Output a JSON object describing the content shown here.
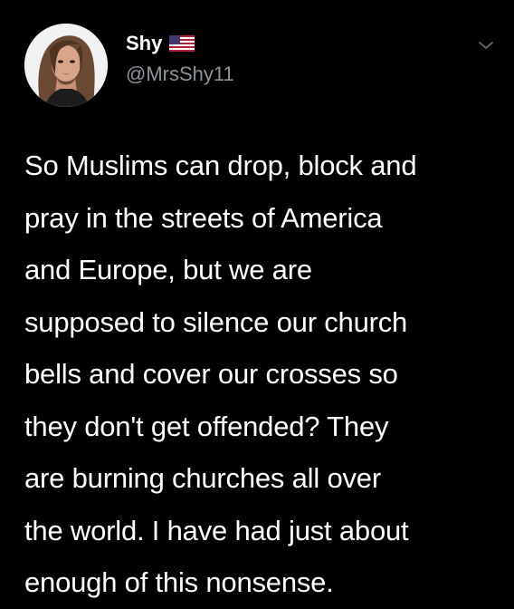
{
  "author": {
    "display_name": "Shy",
    "handle": "@MrsShy11",
    "flag_icon": "us-flag-icon",
    "avatar_icon": "profile-photo"
  },
  "menu": {
    "icon": "chevron-down-icon"
  },
  "tweet": {
    "lines": [
      "So Muslims can drop, block and",
      "pray in the streets of America",
      "and Europe, but we are",
      "supposed to silence our church",
      "bells and cover our crosses so",
      "they don't get offended? They",
      "are burning churches all over",
      "the world.  I have had just about",
      "enough of this nonsense."
    ]
  },
  "colors": {
    "background": "#000000",
    "text": "#ffffff",
    "secondary_text": "#8d9499"
  }
}
